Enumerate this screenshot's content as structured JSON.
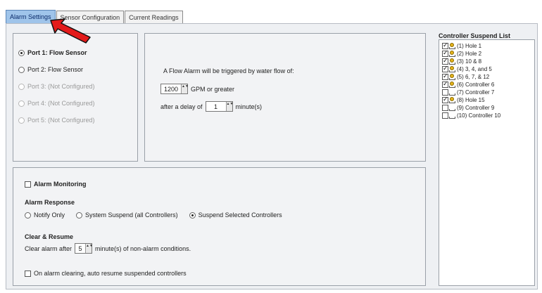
{
  "tabs": [
    "Alarm Settings",
    "Sensor Configuration",
    "Current Readings"
  ],
  "ports": [
    {
      "label": "Port 1:  Flow Sensor",
      "selected": true,
      "enabled": true
    },
    {
      "label": "Port 2:  Flow Sensor",
      "selected": false,
      "enabled": true
    },
    {
      "label": "Port 3:  (Not Configured)",
      "selected": false,
      "enabled": false
    },
    {
      "label": "Port 4:  (Not Configured)",
      "selected": false,
      "enabled": false
    },
    {
      "label": "Port 5:  (Not Configured)",
      "selected": false,
      "enabled": false
    }
  ],
  "flow": {
    "description": "A Flow Alarm will be triggered by water flow of:",
    "gpm_value": "1200",
    "gpm_label": "GPM or greater",
    "delay_prefix": "after a delay of",
    "delay_value": "1",
    "delay_unit": "minute(s)"
  },
  "alarm": {
    "monitoring_label": "Alarm Monitoring",
    "response_title": "Alarm Response",
    "response_options": [
      "Notify Only",
      "System Suspend (all Controllers)",
      "Suspend Selected Controllers"
    ],
    "selected_response": 2,
    "clear_title": "Clear & Resume",
    "clear_prefix": "Clear alarm after",
    "clear_value": "5",
    "clear_suffix": "minute(s) of non-alarm conditions.",
    "auto_resume_label": "On alarm clearing, auto resume suspended controllers"
  },
  "suspend_list": {
    "title": "Controller Suspend List",
    "items": [
      {
        "label": "(1)  Hole 1",
        "checked": true
      },
      {
        "label": "(2)  Hole 2",
        "checked": true
      },
      {
        "label": "(3)  10 & 8",
        "checked": true
      },
      {
        "label": "(4)  3, 4, and 5",
        "checked": true
      },
      {
        "label": "(5)  6, 7, & 12",
        "checked": true
      },
      {
        "label": "(6)  Controller 6",
        "checked": true
      },
      {
        "label": "(7)  Controller 7",
        "checked": false
      },
      {
        "label": "(8)  Hole 15",
        "checked": true
      },
      {
        "label": "(9)  Controller 9",
        "checked": false
      },
      {
        "label": "(10)  Controller 10",
        "checked": false
      }
    ]
  },
  "colors": {
    "active_tab": "#9fc4ea",
    "arrow": "#e31b1b",
    "panel": "#eef0f3"
  }
}
